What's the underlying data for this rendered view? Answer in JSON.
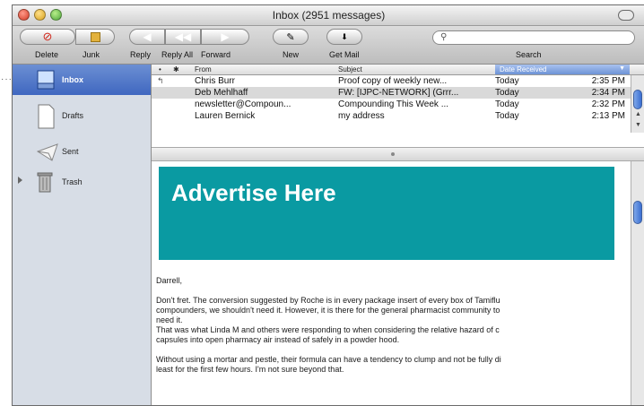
{
  "window": {
    "title": "Inbox (2951 messages)"
  },
  "toolbar": {
    "delete_label": "Delete",
    "junk_label": "Junk",
    "reply_label": "Reply",
    "reply_all_label": "Reply All",
    "forward_label": "Forward",
    "new_label": "New",
    "get_mail_label": "Get Mail",
    "search_label": "Search",
    "search_value": ""
  },
  "sidebar": {
    "items": [
      {
        "label": "Inbox",
        "icon": "inbox-icon",
        "selected": true
      },
      {
        "label": "Drafts",
        "icon": "drafts-icon"
      },
      {
        "label": "Sent",
        "icon": "sent-icon"
      },
      {
        "label": "Trash",
        "icon": "trash-icon"
      }
    ]
  },
  "list": {
    "columns": {
      "status": "•",
      "flag": "✱",
      "from": "From",
      "subject": "Subject",
      "date": "Date Received",
      "sort_indicator": "▼"
    },
    "rows": [
      {
        "status": "↰",
        "from": "Chris Burr",
        "subject": "Proof copy of weekly new...",
        "date": "Today",
        "time": "2:35 PM"
      },
      {
        "status": "",
        "from": "Deb Mehlhaff",
        "subject": "FW: [IJPC-NETWORK] (Grrr...",
        "date": "Today",
        "time": "2:34 PM"
      },
      {
        "status": "",
        "from": "newsletter@Compoun...",
        "subject": "Compounding This Week ...",
        "date": "Today",
        "time": "2:32 PM"
      },
      {
        "status": "",
        "from": "Lauren Bernick",
        "subject": "my address",
        "date": "Today",
        "time": "2:13 PM"
      }
    ]
  },
  "preview": {
    "ad_text": "Advertise Here",
    "salutation": "Darrell,",
    "lines": [
      "Don't fret.  The conversion suggested by Roche is in every package insert of every box of Tamiflu",
      "compounders, we shouldn't need it.  However, it is there for the general pharmacist community to",
      "need it.",
      "That was what Linda M and others were responding to when considering the relative hazard of c",
      "capsules into open pharmacy air instead of safely in a powder hood.",
      "",
      "Without using a mortar and pestle, their formula can have a tendency to clump and not be fully di",
      "least for the first few hours.  I'm not sure beyond that."
    ]
  },
  "callout": {
    "dots": "·····"
  },
  "colors": {
    "ad_background": "#0a9aa2",
    "selection": "#3f67c0",
    "sidebar": "#d7dde6"
  }
}
